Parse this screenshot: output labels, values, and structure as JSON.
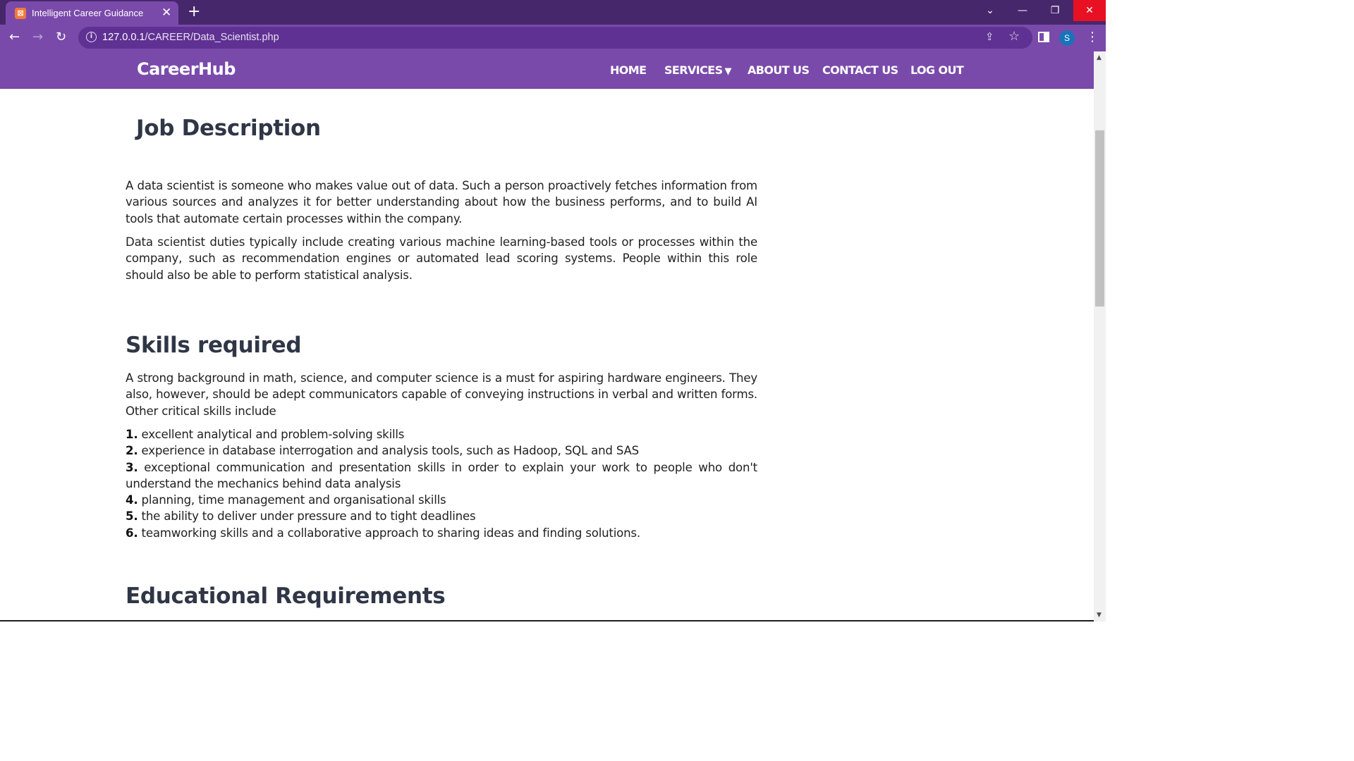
{
  "browser": {
    "tab_title": "Intelligent Career Guidance",
    "tab_favicon": "xampp-icon",
    "new_tab": "+",
    "url_host": "127.0.0.1",
    "url_path": "/CAREER/Data_Scientist.php",
    "profile_initial": "S"
  },
  "site": {
    "brand": "CareerHub",
    "menu": {
      "home": "HOME",
      "services": "SERVICES",
      "about": "ABOUT US",
      "contact": "CONTACT US",
      "logout": "LOG OUT"
    }
  },
  "content": {
    "job_heading": "Job Description",
    "job_p1": "A data scientist is someone who makes value out of data. Such a person proactively fetches information from various sources and analyzes it for better understanding about how the business performs, and to build AI tools that automate certain processes within the company.",
    "job_p2": "Data scientist duties typically include creating various machine learning-based tools or processes within the company, such as recommendation engines or automated lead scoring systems. People within this role should also be able to perform statistical analysis.",
    "skills_heading": "Skills required",
    "skills_intro": "A strong background in math, science, and computer science is a must for aspiring hardware engineers. They also, however, should be adept communicators capable of conveying instructions in verbal and written forms. Other critical skills include",
    "skills": [
      {
        "num": "1.",
        "text": " excellent analytical and problem-solving skills"
      },
      {
        "num": "2.",
        "text": " experience in database interrogation and analysis tools, such as Hadoop, SQL and SAS"
      },
      {
        "num": "3.",
        "text": " exceptional communication and presentation skills in order to explain your work to people who don't understand the mechanics behind data analysis"
      },
      {
        "num": "4.",
        "text": " planning, time management and organisational skills"
      },
      {
        "num": "5.",
        "text": " the ability to deliver under pressure and to tight deadlines"
      },
      {
        "num": "6.",
        "text": " teamworking skills and a collaborative approach to sharing ideas and finding solutions."
      }
    ],
    "edu_heading": "Educational Requirements"
  }
}
